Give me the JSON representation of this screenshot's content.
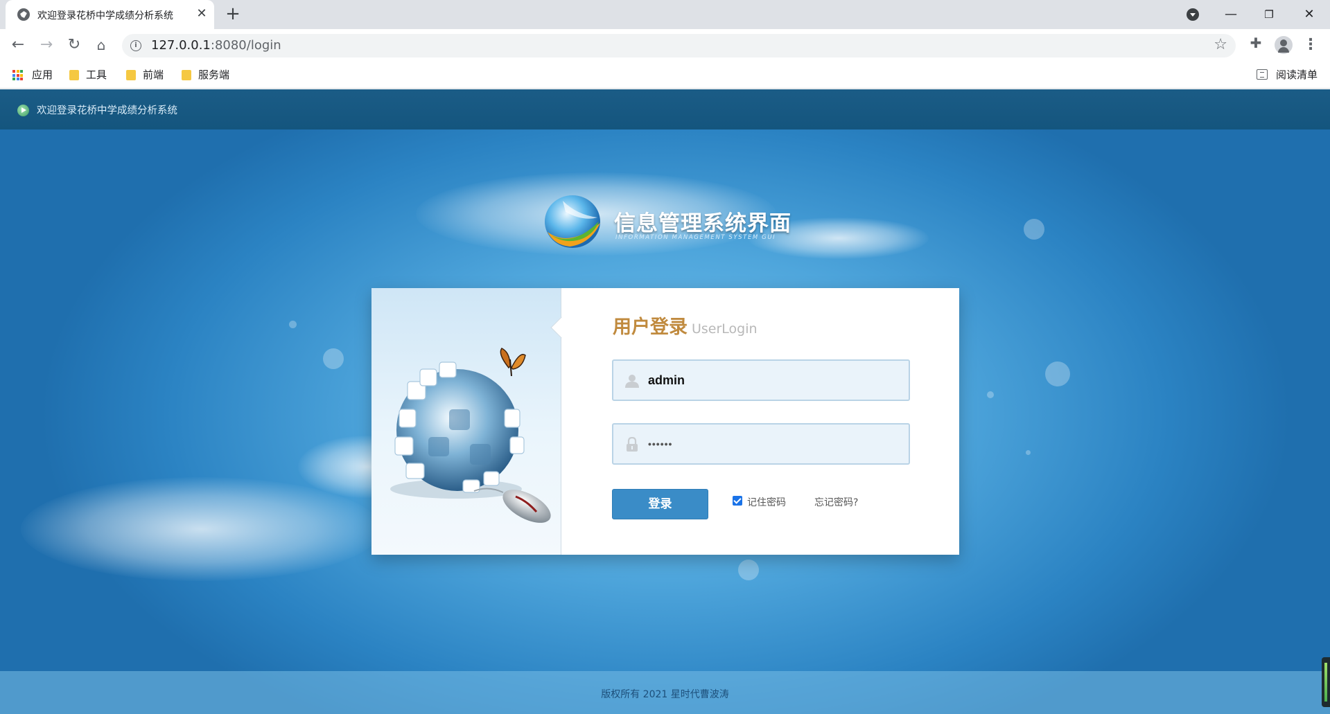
{
  "browser": {
    "tab_title": "欢迎登录花桥中学成绩分析系统",
    "url_host": "127.0.0.1",
    "url_path": ":8080/login",
    "bookmarks": [
      "应用",
      "工具",
      "前端",
      "服务端"
    ],
    "reading_list": "阅读清单"
  },
  "page": {
    "topbar_title": "欢迎登录花桥中学成绩分析系统",
    "logo_title": "信息管理系统界面",
    "logo_subtitle": "INFORMATION MANAGEMENT SYSTEM GUI",
    "login": {
      "heading": "用户登录",
      "heading_en": "UserLogin",
      "username": "admin",
      "password": "••••••",
      "submit": "登录",
      "remember": "记住密码",
      "remember_checked": true,
      "forgot": "忘记密码?"
    },
    "footer": "版权所有 2021 星时代曹波涛"
  },
  "colors": {
    "topbar": "#14557e",
    "heading": "#c08a3e",
    "button": "#3a8cc7"
  }
}
